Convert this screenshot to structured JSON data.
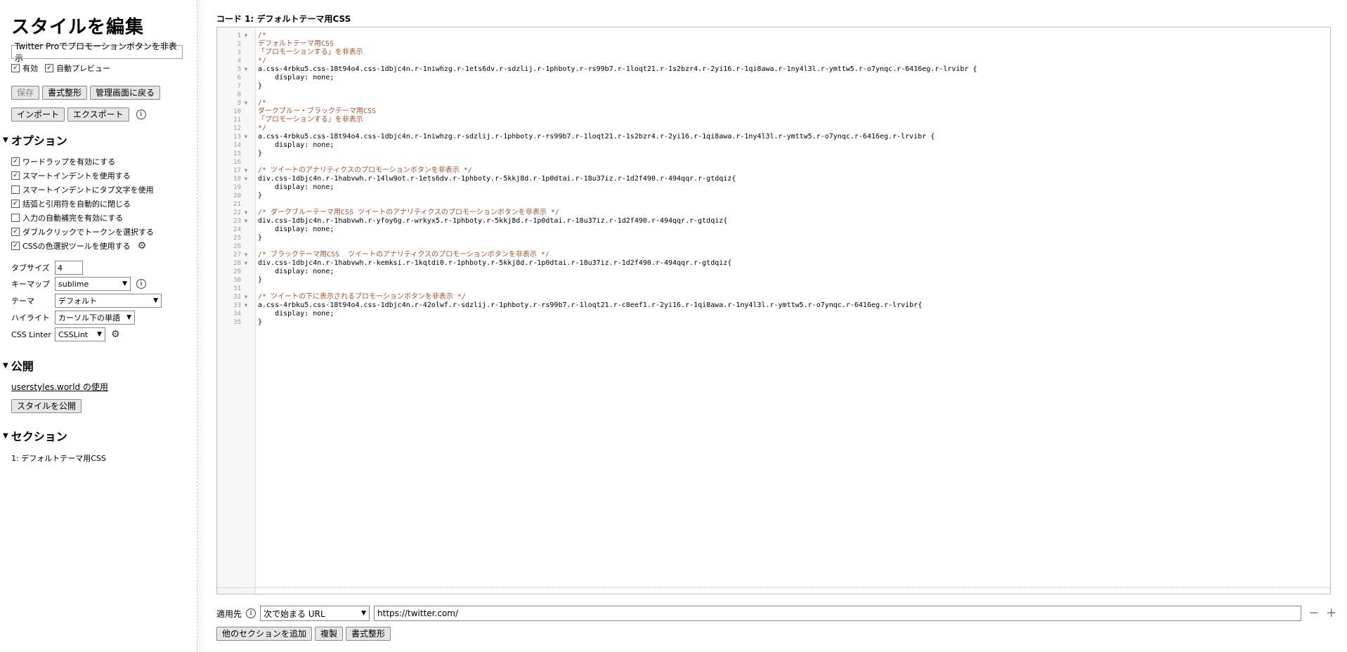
{
  "sidebar": {
    "title": "スタイルを編集",
    "style_name": "Twitter Proでプロモーションボタンを非表示",
    "enabled_label": "有効",
    "live_preview_label": "自動プレビュー",
    "buttons": {
      "save": "保存",
      "beautify": "書式整形",
      "back": "管理画面に戻る",
      "import": "インポート",
      "export": "エクスポート"
    },
    "options_header": "オプション",
    "options": [
      {
        "label": "ワードラップを有効にする",
        "checked": true
      },
      {
        "label": "スマートインデントを使用する",
        "checked": true
      },
      {
        "label": "スマートインデントにタブ文字を使用",
        "checked": false
      },
      {
        "label": "括弧と引用符を自動的に閉じる",
        "checked": true
      },
      {
        "label": "入力の自動補完を有効にする",
        "checked": false
      },
      {
        "label": "ダブルクリックでトークンを選択する",
        "checked": true
      },
      {
        "label": "CSSの色選択ツールを使用する",
        "checked": true
      }
    ],
    "settings": {
      "tab_size_label": "タブサイズ",
      "tab_size": "4",
      "keymap_label": "キーマップ",
      "keymap": "sublime",
      "theme_label": "テーマ",
      "theme": "デフォルト",
      "highlight_label": "ハイライト",
      "highlight": "カーソル下の単語",
      "linter_label": "CSS Linter",
      "linter": "CSSLint"
    },
    "publish_header": "公開",
    "publish_link": "userstyles.world の使用",
    "publish_button": "スタイルを公開",
    "sections_header": "セクション",
    "sections": [
      "1: デフォルトテーマ用CSS"
    ]
  },
  "main": {
    "section_title": "コード 1: デフォルトテーマ用CSS",
    "code_lines": [
      {
        "n": "1",
        "fold": true,
        "text": "/*",
        "comment": true
      },
      {
        "n": "2",
        "fold": false,
        "text": "デフォルトテーマ用CSS",
        "comment": true
      },
      {
        "n": "3",
        "fold": false,
        "text": "「プロモーションする」を非表示",
        "comment": true
      },
      {
        "n": "4",
        "fold": false,
        "text": "*/",
        "comment": true
      },
      {
        "n": "5",
        "fold": true,
        "text": "a.css-4rbku5.css-18t94o4.css-1dbjc4n.r-1niwhzg.r-1ets6dv.r-sdzlij.r-1phboty.r-rs99b7.r-1loqt21.r-1s2bzr4.r-2yi16.r-1qi8awa.r-1ny4l3l.r-ymttw5.r-o7ynqc.r-6416eg.r-lrvibr {",
        "comment": false
      },
      {
        "n": "6",
        "fold": false,
        "text": "    display: none;",
        "comment": false
      },
      {
        "n": "7",
        "fold": false,
        "text": "}",
        "comment": false
      },
      {
        "n": "8",
        "fold": false,
        "text": "",
        "comment": false
      },
      {
        "n": "9",
        "fold": true,
        "text": "/*",
        "comment": true
      },
      {
        "n": "10",
        "fold": false,
        "text": "ダークブルー・ブラックテーマ用CSS",
        "comment": true
      },
      {
        "n": "11",
        "fold": false,
        "text": "「プロモーションする」を非表示",
        "comment": true
      },
      {
        "n": "12",
        "fold": false,
        "text": "*/",
        "comment": true
      },
      {
        "n": "13",
        "fold": true,
        "text": "a.css-4rbku5.css-18t94o4.css-1dbjc4n.r-1niwhzg.r-sdzlij.r-1phboty.r-rs99b7.r-1loqt21.r-1s2bzr4.r-2yi16.r-1qi8awa.r-1ny4l3l.r-ymttw5.r-o7ynqc.r-6416eg.r-lrvibr {",
        "comment": false
      },
      {
        "n": "14",
        "fold": false,
        "text": "    display: none;",
        "comment": false
      },
      {
        "n": "15",
        "fold": false,
        "text": "}",
        "comment": false
      },
      {
        "n": "16",
        "fold": false,
        "text": "",
        "comment": false
      },
      {
        "n": "17",
        "fold": true,
        "text": "/* ツイートのアナリティクスのプロモーションボタンを非表示 */",
        "comment": true
      },
      {
        "n": "18",
        "fold": true,
        "text": "div.css-1dbjc4n.r-1habvwh.r-14lw9ot.r-1ets6dv.r-1phboty.r-5kkj8d.r-1p0dtai.r-18u37iz.r-1d2f490.r-494qqr.r-gtdqiz{",
        "comment": false
      },
      {
        "n": "19",
        "fold": false,
        "text": "    display: none;",
        "comment": false
      },
      {
        "n": "20",
        "fold": false,
        "text": "}",
        "comment": false
      },
      {
        "n": "21",
        "fold": false,
        "text": "",
        "comment": false
      },
      {
        "n": "22",
        "fold": true,
        "text": "/* ダークブルーテーマ用CSS ツイートのアナリティクスのプロモーションボタンを非表示 */",
        "comment": true
      },
      {
        "n": "23",
        "fold": true,
        "text": "div.css-1dbjc4n.r-1habvwh.r-yfoy6g.r-wrkyx5.r-1phboty.r-5kkj8d.r-1p0dtai.r-18u37iz.r-1d2f490.r-494qqr.r-gtdqiz{",
        "comment": false
      },
      {
        "n": "24",
        "fold": false,
        "text": "    display: none;",
        "comment": false
      },
      {
        "n": "25",
        "fold": false,
        "text": "}",
        "comment": false
      },
      {
        "n": "26",
        "fold": false,
        "text": "",
        "comment": false
      },
      {
        "n": "27",
        "fold": true,
        "text": "/* ブラックテーマ用CSS  ツイートのアナリティクスのプロモーションボタンを非表示 */",
        "comment": true
      },
      {
        "n": "28",
        "fold": true,
        "text": "div.css-1dbjc4n.r-1habvwh.r-kemksi.r-1kqtdi0.r-1phboty.r-5kkj8d.r-1p0dtai.r-18u37iz.r-1d2f490.r-494qqr.r-gtdqiz{",
        "comment": false
      },
      {
        "n": "29",
        "fold": false,
        "text": "    display: none;",
        "comment": false
      },
      {
        "n": "30",
        "fold": false,
        "text": "}",
        "comment": false
      },
      {
        "n": "31",
        "fold": false,
        "text": "",
        "comment": false
      },
      {
        "n": "32",
        "fold": true,
        "text": "/* ツイートの下に表示されるプロモーションボタンを非表示 */",
        "comment": true
      },
      {
        "n": "33",
        "fold": true,
        "text": "a.css-4rbku5.css-18t94o4.css-1dbjc4n.r-42olwf.r-sdzlij.r-1phboty.r-rs99b7.r-1loqt21.r-c8eef1.r-2yi16.r-1qi8awa.r-1ny4l3l.r-ymttw5.r-o7ynqc.r-6416eg.r-lrvibr{",
        "comment": false
      },
      {
        "n": "34",
        "fold": false,
        "text": "    display: none;",
        "comment": false
      },
      {
        "n": "35",
        "fold": false,
        "text": "}",
        "comment": false
      }
    ],
    "apply_label": "適用先",
    "apply_type": "次で始まる URL",
    "apply_url": "https://twitter.com/",
    "buttons": {
      "add_section": "他のセクションを追加",
      "clone": "複製",
      "beautify": "書式整形"
    }
  },
  "colors": {
    "comment": "#a0522d",
    "gutter_bg": "#f7f7f7",
    "button_bg": "#e6e6e6"
  }
}
